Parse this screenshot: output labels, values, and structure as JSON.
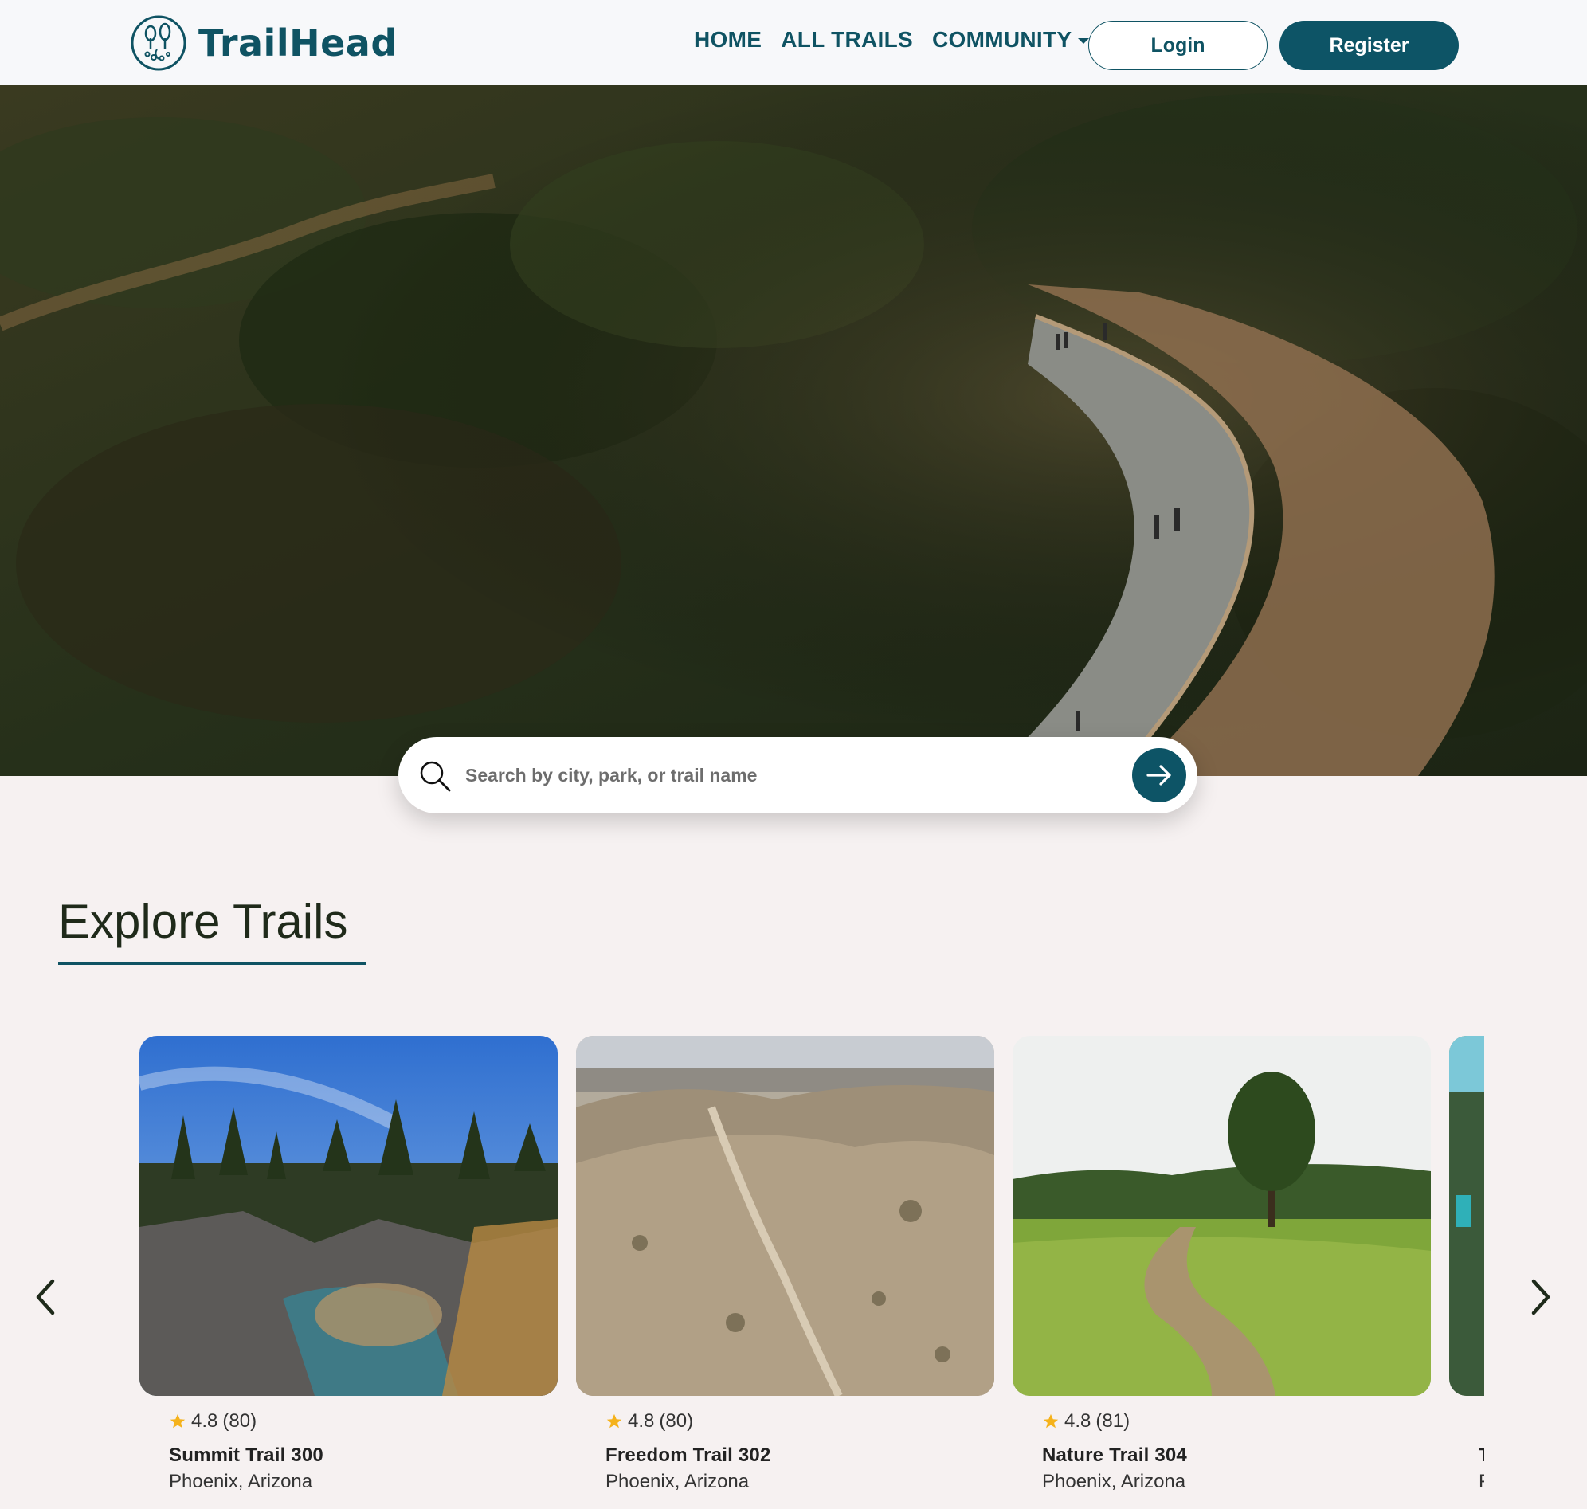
{
  "brand": {
    "name": "TrailHead",
    "accent": "#0f5363"
  },
  "nav": {
    "links": [
      {
        "label": "HOME"
      },
      {
        "label": "ALL TRAILS"
      },
      {
        "label": "COMMUNITY"
      }
    ],
    "login_label": "Login",
    "register_label": "Register"
  },
  "search": {
    "placeholder": "Search by city, park, or trail name",
    "value": ""
  },
  "explore": {
    "title": "Explore Trails",
    "cards": [
      {
        "rating": "4.8",
        "reviews": "(80)",
        "name": "Summit Trail 300",
        "location": "Phoenix, Arizona"
      },
      {
        "rating": "4.8",
        "reviews": "(80)",
        "name": "Freedom Trail 302",
        "location": "Phoenix, Arizona"
      },
      {
        "rating": "4.8",
        "reviews": "(81)",
        "name": "Nature Trail 304",
        "location": "Phoenix, Arizona"
      },
      {
        "rating": "",
        "reviews": "",
        "name": "T",
        "location": "F"
      }
    ]
  }
}
